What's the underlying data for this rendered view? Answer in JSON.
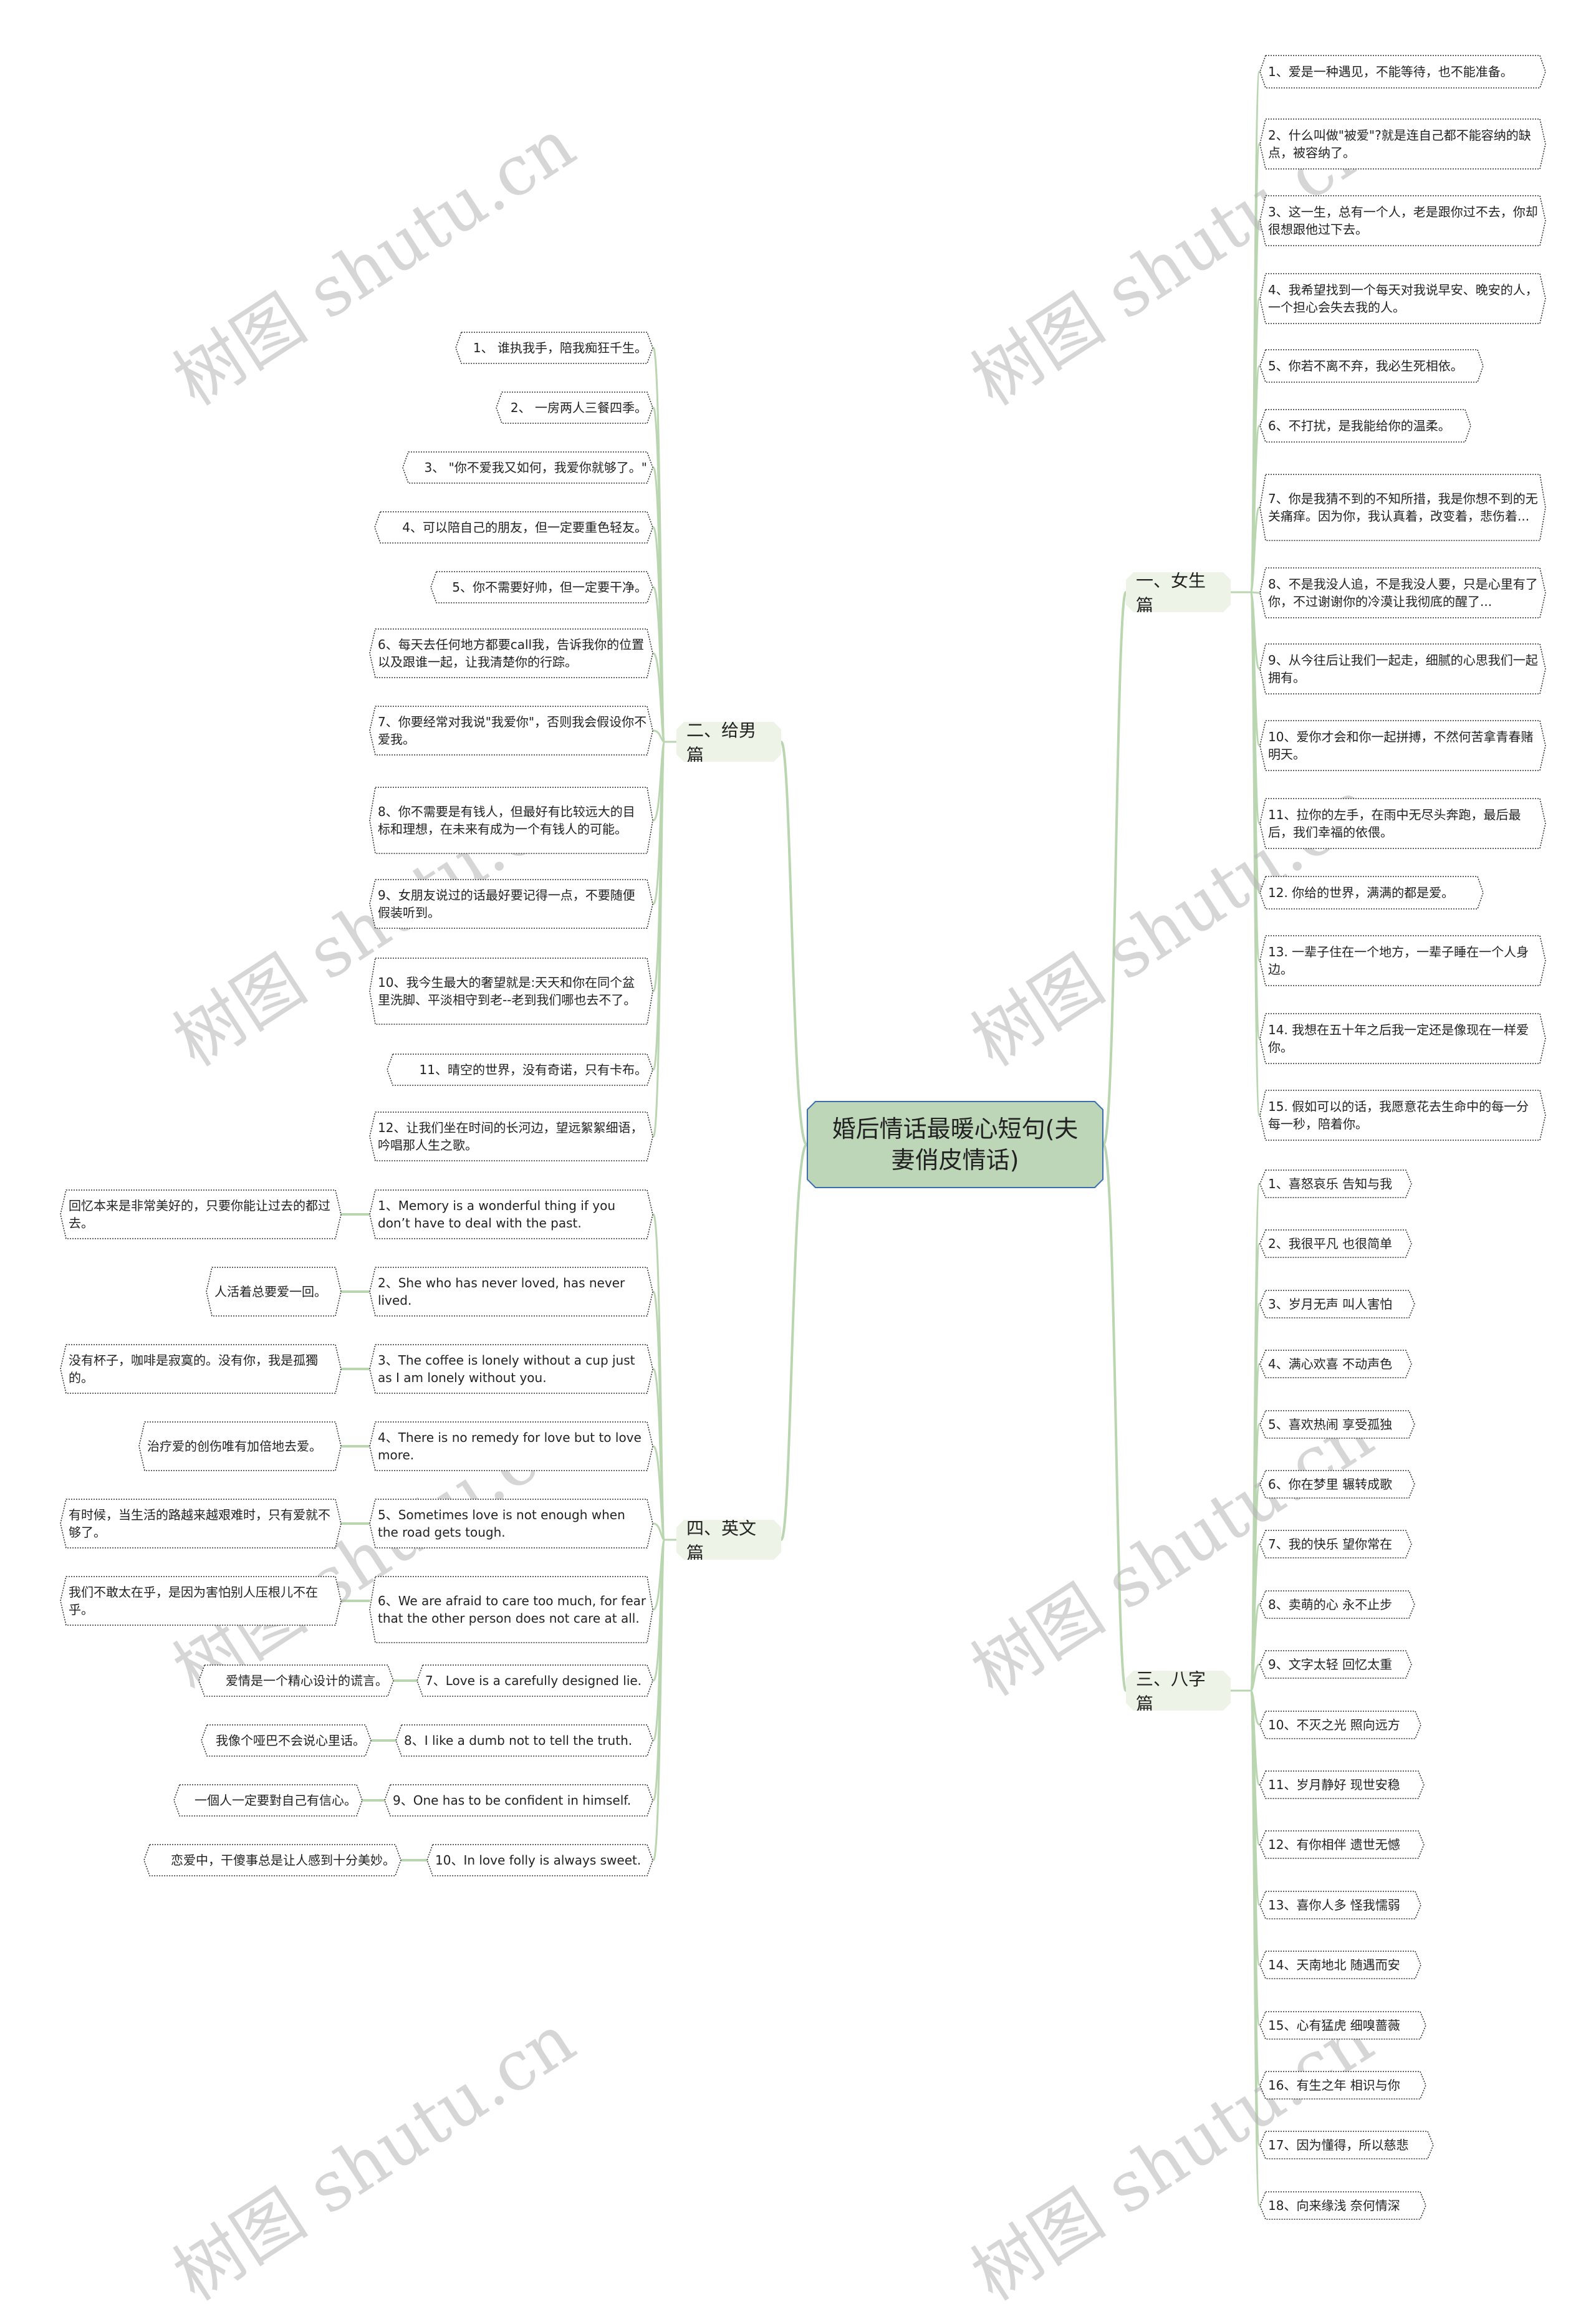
{
  "center": {
    "title": "婚后情话最暖心短句(夫妻俏皮情话)"
  },
  "watermark": "树图 shutu.cn",
  "colors": {
    "center_fill": "#bdd6b8",
    "center_border": "#3b6fb0",
    "branch_fill": "#edf3e6",
    "line": "#b9d6b0",
    "leaf_border": "#333333"
  },
  "branches": {
    "girl": {
      "label": "一、女生篇",
      "items": [
        "1、爱是一种遇见，不能等待，也不能准备。",
        "2、什么叫做\"被爱\"?就是连自己都不能容纳的缺点，被容纳了。",
        "3、这一生，总有一个人，老是跟你过不去，你却很想跟他过下去。",
        "4、我希望找到一个每天对我说早安、晚安的人，一个担心会失去我的人。",
        "5、你若不离不弃，我必生死相依。",
        "6、不打扰，是我能给你的温柔。",
        "7、你是我猜不到的不知所措，我是你想不到的无关痛痒。因为你，我认真着，改变着，悲伤着...",
        "8、不是我没人追，不是我没人要，只是心里有了你，不过谢谢你的冷漠让我彻底的醒了...",
        "9、从今往后让我们一起走，细腻的心思我们一起拥有。",
        "10、爱你才会和你一起拼搏，不然何苦拿青春赌明天。",
        "11、拉你的左手，在雨中无尽头奔跑，最后最后，我们幸福的依偎。",
        "12. 你给的世界，满满的都是爱。",
        "13. 一辈子住在一个地方，一辈子睡在一个人身边。",
        "14. 我想在五十年之后我一定还是像现在一样爱你。",
        "15. 假如可以的话，我愿意花去生命中的每一分每一秒，陪着你。"
      ]
    },
    "boy": {
      "label": "二、给男篇",
      "items": [
        "1、 谁执我手，陪我痴狂千生。",
        "2、 一房两人三餐四季。",
        "3、 \"你不爱我又如何，我爱你就够了。\"",
        "4、可以陪自己的朋友，但一定要重色轻友。",
        "5、你不需要好帅，但一定要干净。",
        "6、每天去任何地方都要call我，告诉我你的位置以及跟谁一起，让我清楚你的行踪。",
        "7、你要经常对我说\"我爱你\"，否则我会假设你不爱我。",
        "8、你不需要是有钱人，但最好有比较远大的目标和理想，在未来有成为一个有钱人的可能。",
        "9、女朋友说过的话最好要记得一点，不要随便假装听到。",
        "10、我今生最大的奢望就是:天天和你在同个盆里洗脚、平淡相守到老--老到我们哪也去不了。",
        "11、晴空的世界，没有奇诺，只有卡布。",
        "12、让我们坐在时间的长河边，望远絮絮细语，吟唱那人生之歌。"
      ]
    },
    "eight": {
      "label": "三、八字篇",
      "items": [
        "1、喜怒哀乐 告知与我",
        "2、我很平凡 也很简单",
        "3、岁月无声 叫人害怕",
        "4、满心欢喜 不动声色",
        "5、喜欢热闹 享受孤独",
        "6、你在梦里 辗转成歌",
        "7、我的快乐 望你常在",
        "8、卖萌的心 永不止步",
        "9、文字太轻 回忆太重",
        "10、不灭之光 照向远方",
        "11、岁月静好 现世安稳",
        "12、有你相伴 遗世无憾",
        "13、喜你人多 怪我懦弱",
        "14、天南地北 随遇而安",
        "15、心有猛虎 细嗅蔷薇",
        "16、有生之年 相识与你",
        "17、因为懂得，所以慈悲",
        "18、向来缘浅 奈何情深"
      ]
    },
    "english": {
      "label": "四、英文篇",
      "items": [
        {
          "en": "1、Memory is a wonderful thing if you don’t have to deal with the past.",
          "zh": "回忆本来是非常美好的，只要你能让过去的都过去。"
        },
        {
          "en": "2、She who has never loved, has never lived.",
          "zh": "人活着总要爱一回。"
        },
        {
          "en": "3、The coffee is lonely without a cup just as I am lonely without you.",
          "zh": "没有杯子，咖啡是寂寞的。没有你，我是孤獨的。"
        },
        {
          "en": "4、There is no remedy for love but to love more.",
          "zh": "治疗爱的创伤唯有加倍地去爱。"
        },
        {
          "en": "5、Sometimes love is not enough when the road gets tough.",
          "zh": "有时候，当生活的路越来越艰难时，只有爱就不够了。"
        },
        {
          "en": "6、We are afraid to care too much, for fear that the other person does not care at all.",
          "zh": "我们不敢太在乎，是因为害怕别人压根儿不在乎。"
        },
        {
          "en": "7、Love is a carefully designed lie.",
          "zh": "爱情是一个精心设计的谎言。"
        },
        {
          "en": "8、I like a dumb not to tell the truth.",
          "zh": "我像个哑巴不会说心里话。"
        },
        {
          "en": "9、One has to be confident in himself.",
          "zh": "一個人一定要對自己有信心。"
        },
        {
          "en": "10、In love folly is always sweet.",
          "zh": "恋爱中，干傻事总是让人感到十分美妙。"
        }
      ]
    }
  }
}
